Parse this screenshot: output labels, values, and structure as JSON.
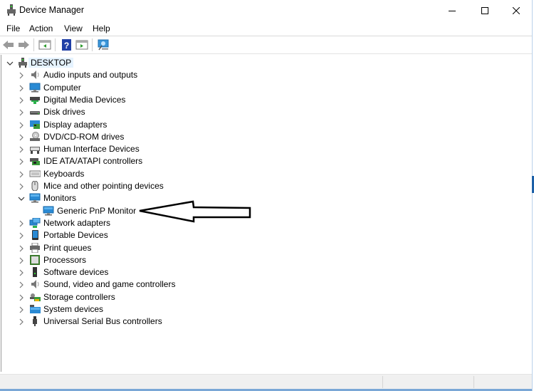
{
  "window": {
    "title": "Device Manager",
    "controls": {
      "minimize": "minimize-icon",
      "maximize": "maximize-icon",
      "close": "close-icon"
    }
  },
  "menu": [
    "File",
    "Action",
    "View",
    "Help"
  ],
  "toolbar": {
    "buttons": [
      {
        "name": "back",
        "icon": "back-arrow-icon"
      },
      {
        "name": "forward",
        "icon": "forward-arrow-icon"
      },
      {
        "name": "show-hide-console-tree",
        "icon": "console-tree-icon"
      },
      {
        "name": "help",
        "icon": "help-icon"
      },
      {
        "name": "show-hide-action-pane",
        "icon": "action-pane-icon"
      },
      {
        "name": "scan-hardware",
        "icon": "monitor-scan-icon"
      }
    ]
  },
  "tree": {
    "root": {
      "label": "DESKTOP",
      "expanded": true
    },
    "items": [
      {
        "label": "Audio inputs and outputs",
        "icon": "speaker-icon",
        "expanded": false
      },
      {
        "label": "Computer",
        "icon": "computer-icon",
        "expanded": false
      },
      {
        "label": "Digital Media Devices",
        "icon": "media-device-icon",
        "expanded": false
      },
      {
        "label": "Disk drives",
        "icon": "disk-drive-icon",
        "expanded": false
      },
      {
        "label": "Display adapters",
        "icon": "display-adapter-icon",
        "expanded": false
      },
      {
        "label": "DVD/CD-ROM drives",
        "icon": "dvd-drive-icon",
        "expanded": false
      },
      {
        "label": "Human Interface Devices",
        "icon": "hid-icon",
        "expanded": false
      },
      {
        "label": "IDE ATA/ATAPI controllers",
        "icon": "ide-controller-icon",
        "expanded": false
      },
      {
        "label": "Keyboards",
        "icon": "keyboard-icon",
        "expanded": false
      },
      {
        "label": "Mice and other pointing devices",
        "icon": "mouse-icon",
        "expanded": false
      },
      {
        "label": "Monitors",
        "icon": "monitor-icon",
        "expanded": true,
        "children": [
          {
            "label": "Generic PnP Monitor",
            "icon": "monitor-icon"
          }
        ]
      },
      {
        "label": "Network adapters",
        "icon": "network-adapter-icon",
        "expanded": false
      },
      {
        "label": "Portable Devices",
        "icon": "portable-device-icon",
        "expanded": false
      },
      {
        "label": "Print queues",
        "icon": "printer-icon",
        "expanded": false
      },
      {
        "label": "Processors",
        "icon": "processor-icon",
        "expanded": false
      },
      {
        "label": "Software devices",
        "icon": "software-device-icon",
        "expanded": false
      },
      {
        "label": "Sound, video and game controllers",
        "icon": "speaker-icon",
        "expanded": false
      },
      {
        "label": "Storage controllers",
        "icon": "storage-controller-icon",
        "expanded": false
      },
      {
        "label": "System devices",
        "icon": "system-devices-icon",
        "expanded": false
      },
      {
        "label": "Universal Serial Bus controllers",
        "icon": "usb-icon",
        "expanded": false
      }
    ]
  },
  "annotation": {
    "type": "arrow",
    "points_to": "Generic PnP Monitor"
  },
  "colors": {
    "selection": "#e5f3ff",
    "monitor_blue": "#2a8ad4",
    "border_blue": "#7aa7d6"
  }
}
